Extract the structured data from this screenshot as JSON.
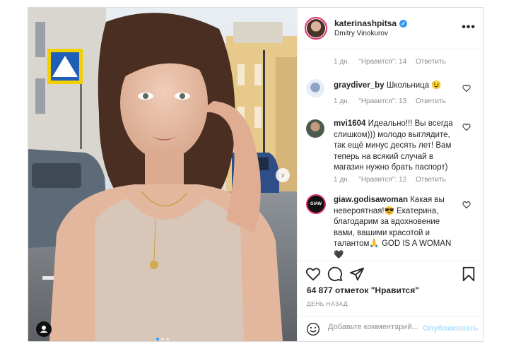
{
  "header": {
    "username": "katerinashpitsa",
    "subtitle": "Dmitry Vinokurov",
    "verified_mark": "✓",
    "more_label": "•••"
  },
  "comments": [
    {
      "username": "",
      "text": "",
      "time": "1 дн.",
      "likes": "\"Нравится\": 14",
      "reply": "Ответить"
    },
    {
      "username": "graydiver_by",
      "text": "Школьница 😉",
      "time": "1 дн.",
      "likes": "\"Нравится\": 13",
      "reply": "Ответить"
    },
    {
      "username": "mvi1604",
      "text": "Идеально!!! Вы всегда слишком))) молодо выглядите, так ещё минус десять лет! Вам теперь на всякий случай в магазин нужно брать паспорт)",
      "time": "1 дн.",
      "likes": "\"Нравится\": 12",
      "reply": "Ответить"
    },
    {
      "username": "giaw.godisawoman",
      "avatar_text": "GIAW",
      "text": "Какая вы невероятная!😎 Екатерина, благодарим за вдохновение вами, вашими красотой и талантом🙏 GOD IS A WOMAN 🖤"
    }
  ],
  "actions": {
    "likes": "64 877 отметок \"Нравится\"",
    "time": "День назад"
  },
  "add_comment": {
    "placeholder": "Добавьте комментарий...",
    "post_label": "Опубликовать",
    "emoji_icon": "smiley-icon"
  },
  "icons": [
    "heart-icon",
    "comment-icon",
    "share-icon",
    "bookmark-icon",
    "more-icon",
    "verified-icon",
    "tag-user-icon",
    "chevron-right-icon"
  ],
  "colors": {
    "accent": "#3897f0",
    "post_disabled": "#b2dffc",
    "muted": "#8e8e8e",
    "border": "#dbdbdb"
  }
}
